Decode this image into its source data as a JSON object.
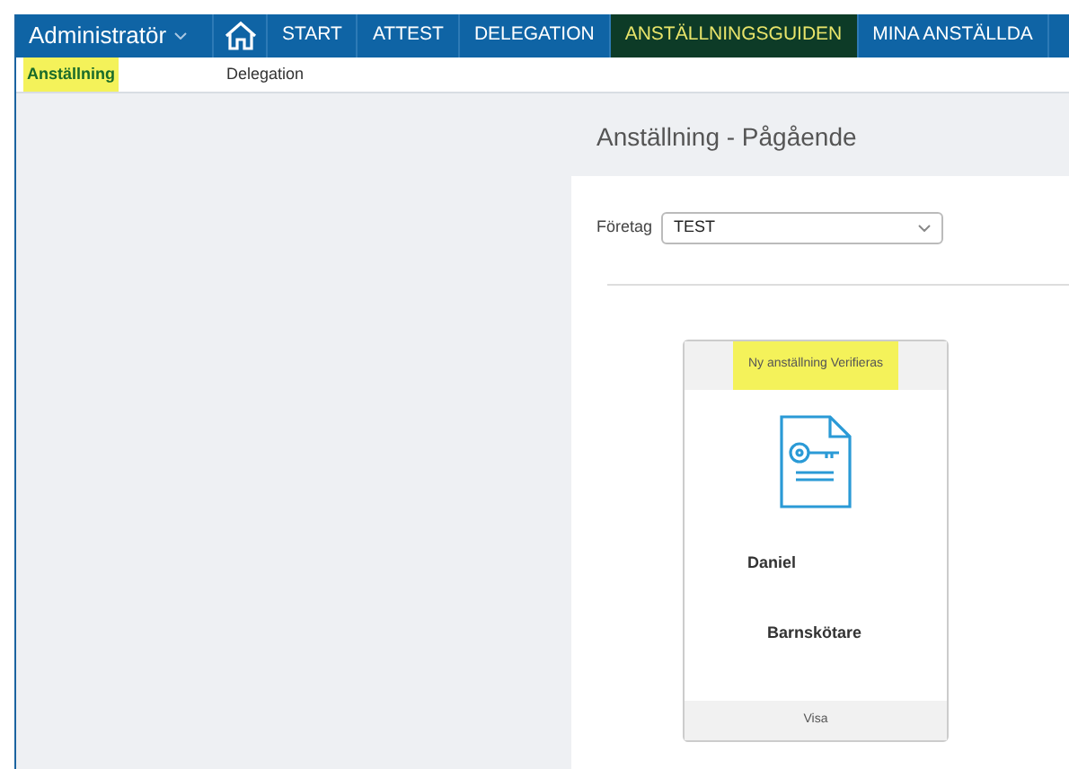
{
  "nav": {
    "role": "Administratör",
    "items": [
      {
        "label": "START",
        "selected": false
      },
      {
        "label": "ATTEST",
        "selected": false
      },
      {
        "label": "DELEGATION",
        "selected": false
      },
      {
        "label": "ANSTÄLLNINGSGUIDEN",
        "selected": true
      },
      {
        "label": "MINA ANSTÄLLDA",
        "selected": false
      }
    ]
  },
  "subnav": [
    {
      "label": "Anställning",
      "selected": true,
      "highlighted": true
    },
    {
      "label": "Delegation",
      "selected": false,
      "highlighted": false
    }
  ],
  "page_title": "Anställning - Pågående",
  "company": {
    "label": "Företag",
    "value": "TEST"
  },
  "cards": [
    {
      "status": "Ny anställning Verifieras",
      "status_highlighted": true,
      "name": "Daniel",
      "role": "Barnskötare",
      "action": "Visa"
    }
  ]
}
